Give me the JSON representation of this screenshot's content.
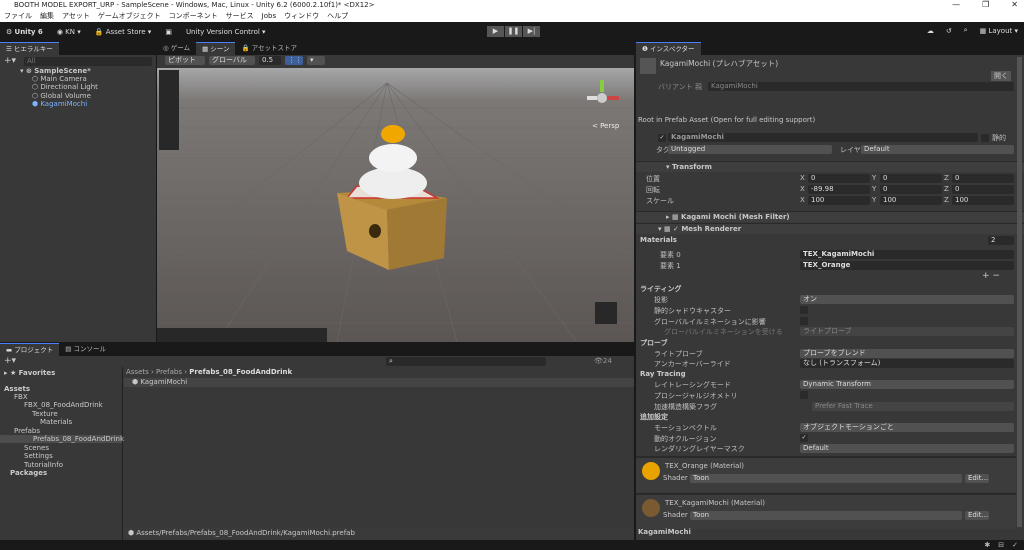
{
  "window": {
    "title": "BOOTH MODEL EXPORT_URP - SampleScene - Windows, Mac, Linux - Unity 6.2 (6000.2.10f1)* <DX12>",
    "controls": [
      "—",
      "❐",
      "✕"
    ]
  },
  "menu": [
    "ファイル",
    "編集",
    "アセット",
    "ゲームオブジェクト",
    "コンポーネント",
    "サービス",
    "Jobs",
    "ウィンドウ",
    "ヘルプ"
  ],
  "toolbar": {
    "unity": "Unity 6",
    "account": "KN",
    "asset_store": "Asset Store",
    "version_control": "Unity Version Control",
    "layout": "Layout"
  },
  "hierarchy": {
    "tab": "ヒエラルキー",
    "search_placeholder": "All",
    "scene": "SampleScene*",
    "items": [
      "Main Camera",
      "Directional Light",
      "Global Volume",
      "KagamiMochi"
    ]
  },
  "scene": {
    "tabs": [
      "ゲーム",
      "シーン",
      "アセットストア"
    ],
    "pivot": "ピボット",
    "global": "グローバル",
    "snap": "0.5",
    "persp": "< Persp"
  },
  "inspector": {
    "tab": "インスペクター",
    "title": "KagamiMochi (プレハブアセット)",
    "open": "開く",
    "variant_label": "バリアント 親",
    "variant_value": "KagamiMochi",
    "root_note": "Root in Prefab Asset (Open for full editing support)",
    "name": "KagamiMochi",
    "static": "静的",
    "tag_label": "タグ",
    "tag": "Untagged",
    "layer_label": "レイヤー",
    "layer": "Default",
    "transform": {
      "title": "Transform",
      "rows": [
        {
          "label": "位置",
          "x": "0",
          "y": "0",
          "z": "0"
        },
        {
          "label": "回転",
          "x": "-89.98",
          "y": "0",
          "z": "0"
        },
        {
          "label": "スケール",
          "x": "100",
          "y": "100",
          "z": "100"
        }
      ]
    },
    "mesh_filter": "Kagami Mochi (Mesh Filter)",
    "mesh_renderer": "Mesh Renderer",
    "materials_label": "Materials",
    "materials_count": "2",
    "materials": [
      {
        "label": "要素 0",
        "value": "TEX_KagamiMochi"
      },
      {
        "label": "要素 1",
        "value": "TEX_Orange"
      }
    ],
    "lighting": {
      "title": "ライティング",
      "cast_label": "投影",
      "cast": "オン",
      "static_shadow": "静的シャドウキャスター",
      "gi_contrib": "グローバルイルミネーションに影響",
      "gi_receive": "グローバルイルミネーションを受ける",
      "gi_receive_value": "ライトプローブ"
    },
    "probes": {
      "title": "プローブ",
      "light_probe_label": "ライトプローブ",
      "light_probe": "プローブをブレンド",
      "anchor_label": "アンカーオーバーライド",
      "anchor": "なし (トランスフォーム)"
    },
    "ray": {
      "title": "Ray Tracing",
      "mode_label": "レイトレーシングモード",
      "mode": "Dynamic Transform",
      "procedural": "プロシージャルジオメトリ",
      "accel_label": "加速構造構築フラグ",
      "accel": "Prefer Fast Trace"
    },
    "additional": {
      "title": "追加設定",
      "motion_label": "モーションベクトル",
      "motion": "オブジェクトモーションごと",
      "occlusion": "動的オクルージョン",
      "mask_label": "レンダリングレイヤーマスク",
      "mask": "Default"
    },
    "material_cards": [
      {
        "title": "TEX_Orange (Material)",
        "shader_label": "Shader",
        "shader": "Toon",
        "edit": "Edit..."
      },
      {
        "title": "TEX_KagamiMochi (Material)",
        "shader_label": "Shader",
        "shader": "Toon",
        "edit": "Edit..."
      }
    ],
    "footer": "KagamiMochi"
  },
  "project": {
    "tabs": [
      "プロジェクト",
      "コンソール"
    ],
    "favorites": "Favorites",
    "tree": [
      "Assets",
      "FBX",
      "FBX_08_FoodAndDrink",
      "Texture",
      "Materials",
      "Prefabs",
      "Prefabs_08_FoodAndDrink",
      "Scenes",
      "Settings",
      "TutorialInfo",
      "Packages"
    ],
    "breadcrumb": [
      "Assets",
      "Prefabs",
      "Prefabs_08_FoodAndDrink"
    ],
    "item": "KagamiMochi",
    "hidden_count": "24",
    "path": "Assets/Prefabs/Prefabs_08_FoodAndDrink/KagamiMochi.prefab"
  },
  "colors": {
    "accent": "#4c7fff",
    "panel": "#383838",
    "bg": "#191919"
  }
}
